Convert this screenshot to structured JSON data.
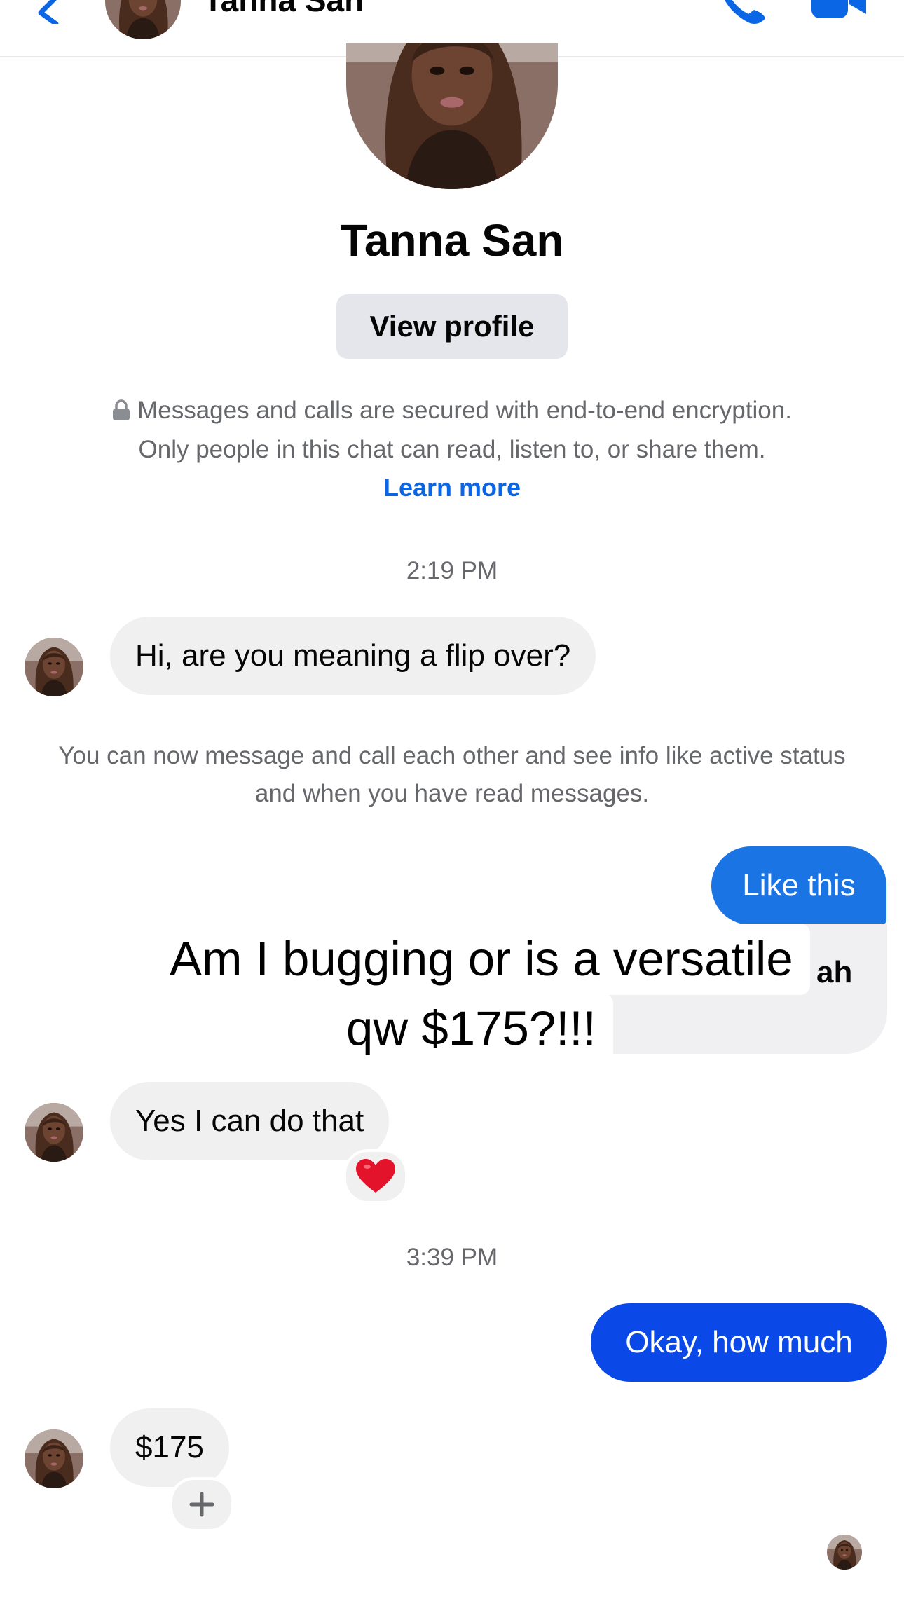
{
  "header": {
    "contact_name": "Tanna San",
    "icons": [
      "back-chevron-icon",
      "phone-icon",
      "video-camera-icon"
    ],
    "accent": "#0a66e4"
  },
  "profile": {
    "name": "Tanna San",
    "view_profile_label": "View profile"
  },
  "encryption_notice": {
    "line1": "Messages and calls are secured with end-to-end encryption.",
    "line2": "Only people in this chat can read, listen to, or share them.",
    "learn_more": "Learn more",
    "icon": "lock-icon"
  },
  "conversation": {
    "timestamp_1": "2:19 PM",
    "msg_1": "Hi, are you meaning a flip over?",
    "system_note": "You can now message and call each other and see info like active status and when you have read messages.",
    "msg_2": "Like this",
    "msg_3_visible_fragment": "ah",
    "msg_4": "Yes I can do that",
    "msg_4_reaction": "❤️",
    "timestamp_2": "3:39 PM",
    "msg_5": "Okay, how much",
    "msg_6": "$175",
    "add_reaction": "+"
  },
  "overlay_caption": {
    "line1": "Am I bugging or is a versatile",
    "line2": "qw $175?!!!"
  },
  "colors": {
    "incoming_bubble": "#f0f0f0",
    "outgoing_light": "#1b74e4",
    "outgoing_dark": "#0a49e8",
    "secondary_text": "#65676b"
  }
}
